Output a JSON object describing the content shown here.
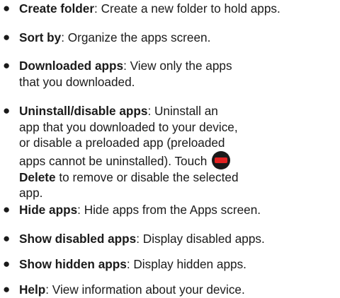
{
  "items": [
    {
      "term": "Create folder",
      "desc": ": Create a new folder to hold apps."
    },
    {
      "term": "Sort by",
      "desc": ": Organize the apps screen."
    },
    {
      "term": "Downloaded apps",
      "desc": ": View only the apps that you downloaded."
    },
    {
      "term": "Uninstall/disable apps",
      "desc_before": ": Uninstall an app that you downloaded to your device, or disable a preloaded app (preloaded apps cannot be uninstalled). Touch ",
      "icon": "delete-icon",
      "action": "Delete",
      "desc_after": " to remove or disable the selected app."
    },
    {
      "term": "Hide apps",
      "desc": ": Hide apps from the Apps screen."
    },
    {
      "term": "Show disabled apps",
      "desc": ": Display disabled apps."
    },
    {
      "term": "Show hidden apps",
      "desc": ": Display hidden apps."
    },
    {
      "term": "Help",
      "desc": ": View information about your device."
    }
  ]
}
